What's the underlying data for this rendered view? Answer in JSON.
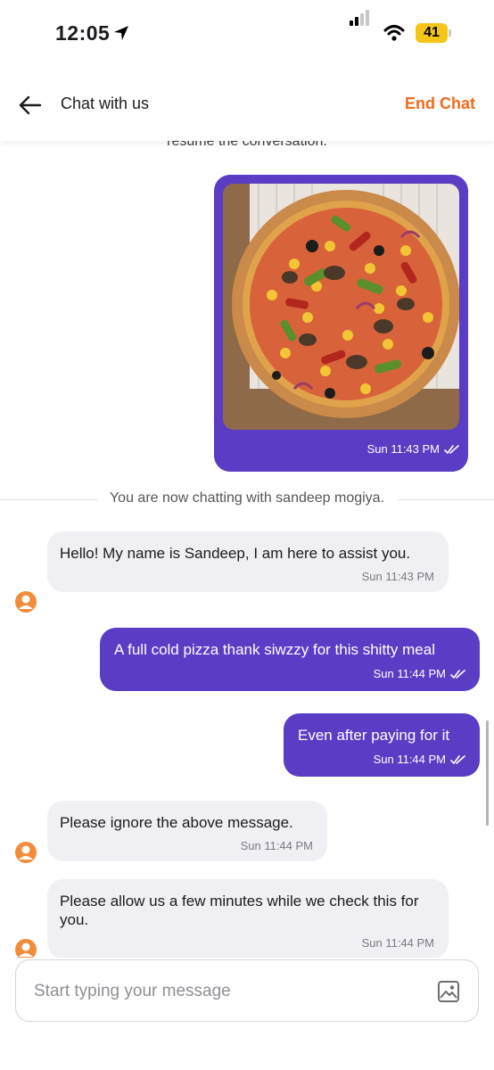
{
  "status_bar": {
    "time": "12:05",
    "battery": "41",
    "icons": [
      "location-arrow-icon",
      "cellular-signal-icon",
      "wifi-icon",
      "battery-icon"
    ]
  },
  "header": {
    "title": "Chat with us",
    "end_chat_label": "End Chat"
  },
  "chat": {
    "cut_notice": "resume the conversation.",
    "image_message": {
      "time": "Sun 11:43 PM"
    },
    "system_message": "You are now chatting with sandeep mogiya.",
    "messages": [
      {
        "direction": "in",
        "text": "Hello! My name is Sandeep, I am here to assist you.",
        "time": "Sun 11:43 PM"
      },
      {
        "direction": "out",
        "text": "A full cold pizza thank siwzzy for this shitty meal",
        "time": "Sun 11:44 PM"
      },
      {
        "direction": "out",
        "text": "Even after paying for it",
        "time": "Sun 11:44 PM"
      },
      {
        "direction": "in",
        "text": "Please ignore the above message.",
        "time": "Sun 11:44 PM"
      },
      {
        "direction": "in",
        "text": "Please allow us a few minutes while we check this for you.",
        "time": "Sun 11:44 PM"
      }
    ]
  },
  "composer": {
    "placeholder": "Start typing your message",
    "value": ""
  },
  "colors": {
    "accent_orange": "#f26a1b",
    "bubble_purple": "#5b3cc4",
    "bubble_grey": "#f0f0f4",
    "battery_yellow": "#f5c518"
  }
}
